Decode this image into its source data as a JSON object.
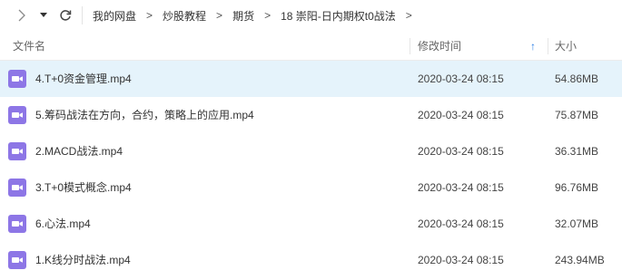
{
  "toolbar": {
    "back_icon": "chevron-right-icon",
    "menu_icon": "caret-down-icon",
    "refresh_icon": "refresh-icon"
  },
  "breadcrumb": [
    {
      "label": "我的网盘"
    },
    {
      "label": "炒股教程"
    },
    {
      "label": "期货"
    },
    {
      "label": "18 崇阳-日内期权t0战法"
    }
  ],
  "breadcrumb_separator": ">",
  "columns": {
    "name": "文件名",
    "date": "修改时间",
    "size": "大小",
    "sort_indicator": "↑"
  },
  "files": [
    {
      "name": "4.T+0资金管理.mp4",
      "date": "2020-03-24 08:15",
      "size": "54.86MB",
      "selected": true
    },
    {
      "name": "5.筹码战法在方向，合约，策略上的应用.mp4",
      "date": "2020-03-24 08:15",
      "size": "75.87MB",
      "selected": false
    },
    {
      "name": "2.MACD战法.mp4",
      "date": "2020-03-24 08:15",
      "size": "36.31MB",
      "selected": false
    },
    {
      "name": "3.T+0模式概念.mp4",
      "date": "2020-03-24 08:15",
      "size": "96.76MB",
      "selected": false
    },
    {
      "name": "6.心法.mp4",
      "date": "2020-03-24 08:15",
      "size": "32.07MB",
      "selected": false
    },
    {
      "name": "1.K线分时战法.mp4",
      "date": "2020-03-24 08:15",
      "size": "243.94MB",
      "selected": false
    }
  ],
  "colors": {
    "accent": "#2b7ee6",
    "selected_row": "#e5f3fb",
    "video_icon": "#8d76e6"
  }
}
